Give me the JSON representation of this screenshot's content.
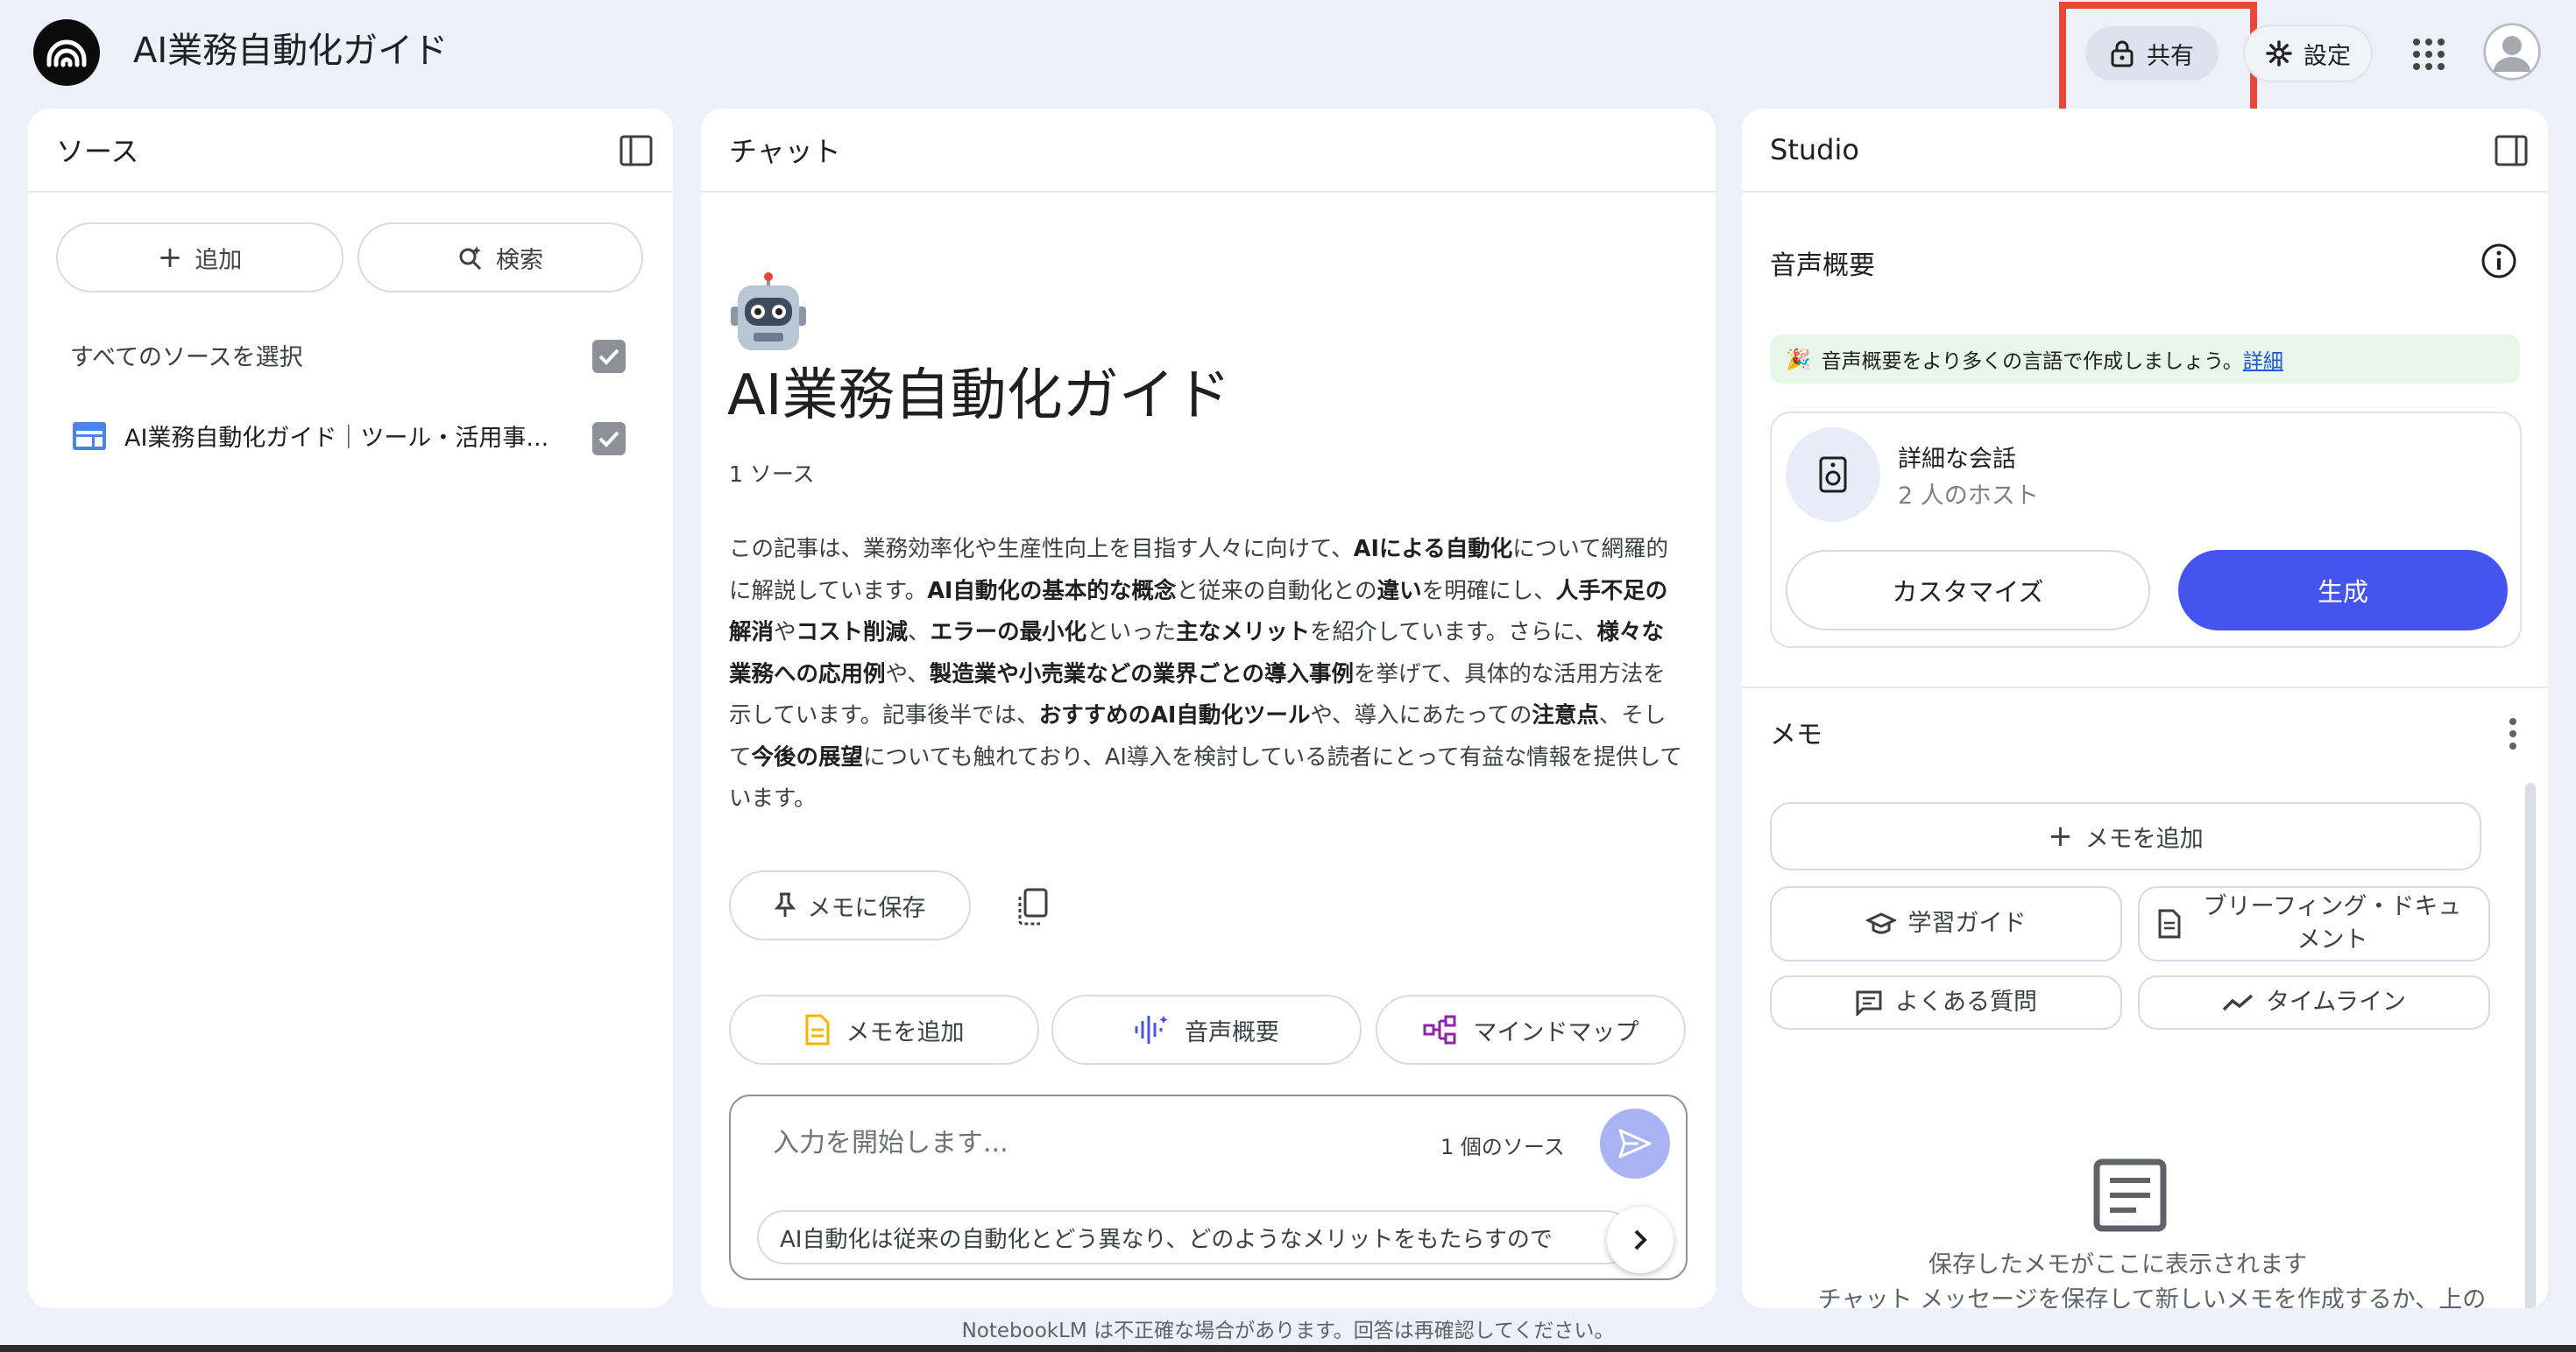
{
  "app": {
    "title": "AI業務自動化ガイド"
  },
  "header": {
    "share_label": "共有",
    "settings_label": "設定"
  },
  "colors": {
    "accent": "#4454ee",
    "highlight": "#e8463a",
    "banner_bg": "#e8f6ea"
  },
  "sources": {
    "title": "ソース",
    "add_label": "追加",
    "search_label": "検索",
    "select_all_label": "すべてのソースを選択",
    "items": [
      {
        "label": "AI業務自動化ガイド｜ツール・活用事...",
        "checked": true
      }
    ]
  },
  "chat": {
    "title": "チャット",
    "notebook_title": "AI業務自動化ガイド",
    "source_count": "1 ソース",
    "summary": [
      {
        "t": "この記事は、業務効率化や生産性向上を目指す人々に向けて、"
      },
      {
        "t": "AIによる自動化",
        "b": true
      },
      {
        "t": "について網羅的に解説しています。"
      },
      {
        "t": "AI自動化の基本的な概念",
        "b": true
      },
      {
        "t": "と従来の自動化との"
      },
      {
        "t": "違い",
        "b": true
      },
      {
        "t": "を明確にし、"
      },
      {
        "t": "人手不足の解消",
        "b": true
      },
      {
        "t": "や"
      },
      {
        "t": "コスト削減",
        "b": true
      },
      {
        "t": "、"
      },
      {
        "t": "エラーの最小化",
        "b": true
      },
      {
        "t": "といった"
      },
      {
        "t": "主なメリット",
        "b": true
      },
      {
        "t": "を紹介しています。さらに、"
      },
      {
        "t": "様々な業務への応用例",
        "b": true
      },
      {
        "t": "や、"
      },
      {
        "t": "製造業や小売業などの業界ごとの導入事例",
        "b": true
      },
      {
        "t": "を挙げて、具体的な活用方法を示しています。記事後半では、"
      },
      {
        "t": "おすすめのAI自動化ツール",
        "b": true
      },
      {
        "t": "や、導入にあたっての"
      },
      {
        "t": "注意点",
        "b": true
      },
      {
        "t": "、そして"
      },
      {
        "t": "今後の展望",
        "b": true
      },
      {
        "t": "についても触れており、AI導入を検討している読者にとって有益な情報を提供しています。"
      }
    ],
    "save_memo_label": "メモに保存",
    "actions": {
      "add_memo": "メモを追加",
      "audio_overview": "音声概要",
      "mind_map": "マインドマップ"
    },
    "input_placeholder": "入力を開始します...",
    "input_sources": "1 個のソース",
    "suggestion": "AI自動化は従来の自動化とどう異なり、どのようなメリットをもたらすので"
  },
  "studio": {
    "title": "Studio",
    "audio_title": "音声概要",
    "banner_text": "音声概要をより多くの言語で作成しましょう。",
    "banner_link": "詳細",
    "conv_title": "詳細な会話",
    "conv_sub": "2 人のホスト",
    "customize_label": "カスタマイズ",
    "generate_label": "生成",
    "memo_title": "メモ",
    "memo_add_label": "メモを追加",
    "study_guide_label": "学習ガイド",
    "briefing_label": "ブリーフィング・ドキュメント",
    "faq_label": "よくある質問",
    "timeline_label": "タイムライン",
    "empty_text1": "保存したメモがここに表示されます",
    "empty_text2": "チャット メッセージを保存して新しいメモを作成するか、上の"
  },
  "footer": {
    "note": "NotebookLM は不正確な場合があります。回答は再確認してください。"
  }
}
